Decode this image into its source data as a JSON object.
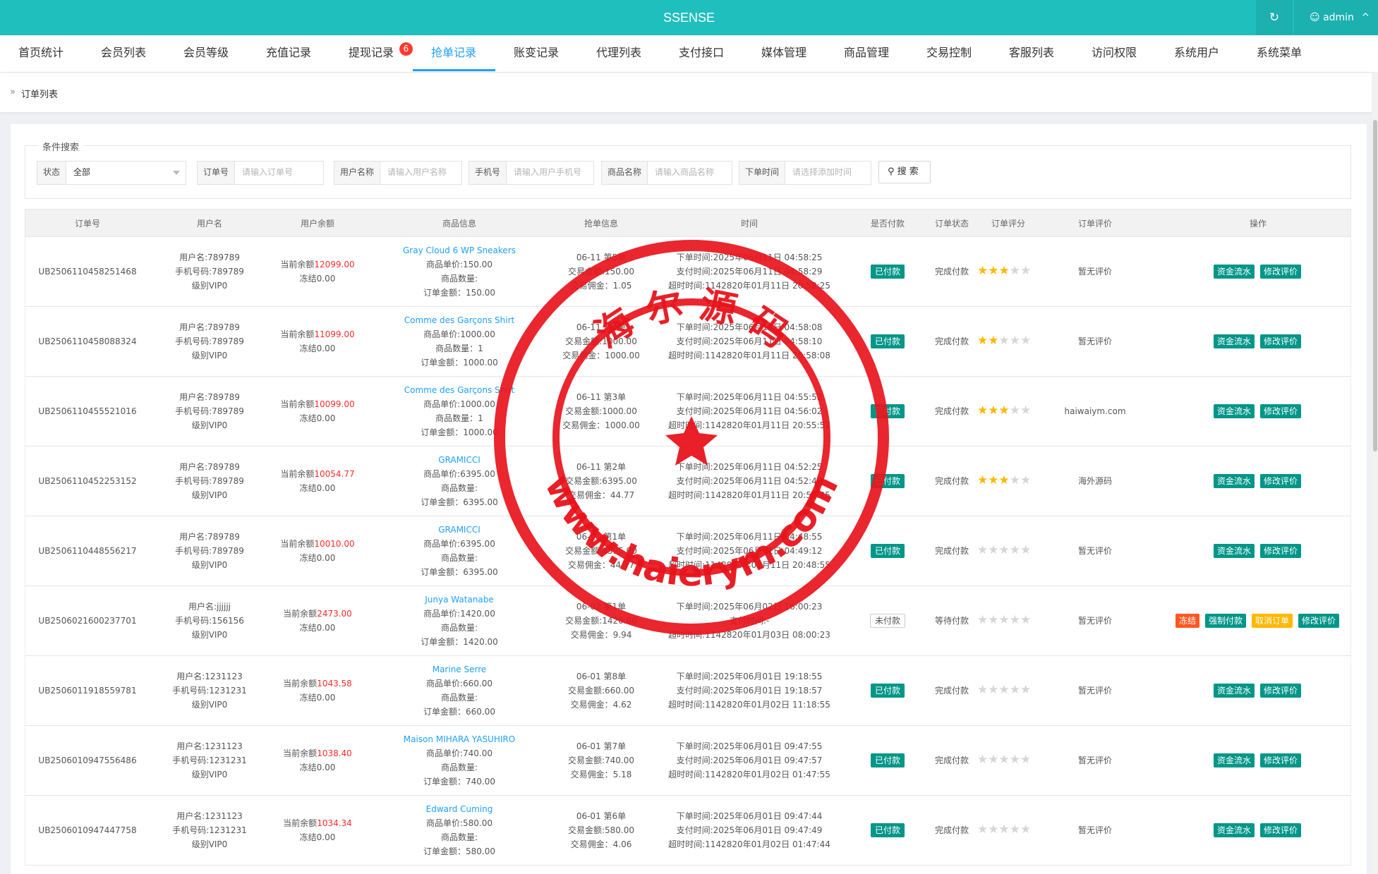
{
  "app": {
    "title": "SSENSE",
    "refresh_icon": "refresh-icon",
    "user_label": "admin",
    "user_icon": "user-icon",
    "user_caret": "^"
  },
  "nav": {
    "items": [
      {
        "label": "首页统计"
      },
      {
        "label": "会员列表"
      },
      {
        "label": "会员等级"
      },
      {
        "label": "充值记录"
      },
      {
        "label": "提现记录",
        "badge": "6"
      },
      {
        "label": "抢单记录",
        "active": true
      },
      {
        "label": "账变记录"
      },
      {
        "label": "代理列表"
      },
      {
        "label": "支付接口"
      },
      {
        "label": "媒体管理"
      },
      {
        "label": "商品管理"
      },
      {
        "label": "交易控制"
      },
      {
        "label": "客服列表"
      },
      {
        "label": "访问权限"
      },
      {
        "label": "系统用户"
      },
      {
        "label": "系统菜单"
      }
    ]
  },
  "breadcrumb": {
    "icon": "»",
    "label": "订单列表"
  },
  "search": {
    "legend": "条件搜索",
    "status": {
      "label": "状态",
      "value": "全部"
    },
    "order_no": {
      "label": "订单号",
      "placeholder": "请输入订单号"
    },
    "username": {
      "label": "用户名称",
      "placeholder": "请输入用户名称"
    },
    "phone": {
      "label": "手机号",
      "placeholder": "请输入用户手机号"
    },
    "goods": {
      "label": "商品名称",
      "placeholder": "请输入商品名称"
    },
    "time": {
      "label": "下单时间",
      "placeholder": "请选择添加时间"
    },
    "button": "搜 索"
  },
  "table": {
    "headers": [
      "订单号",
      "用户名",
      "用户余额",
      "商品信息",
      "抢单信息",
      "时间",
      "是否付款",
      "订单状态",
      "订单评分",
      "订单评价",
      "操作"
    ],
    "rows": [
      {
        "order_no": "UB2506110458251468",
        "user": "用户名:789789",
        "phone": "手机号码:789789",
        "level": "级别VIP0",
        "bal_prefix": "当前余额",
        "bal": "12099.00",
        "frozen": "冻结0.00",
        "goods": "Gray Cloud 6 WP Sneakers",
        "price": "商品单价:150.00",
        "qty": "商品数量:",
        "amount": "订单金额：150.00",
        "grab": "06-11 第5单",
        "deal": "交易金额:150.00",
        "comm": "交易佣金：1.05",
        "t1": "下单时间:2025年06月11日 04:58:25",
        "t2": "支付时间:2025年06月11日 04:58:29",
        "t3": "超时时间:1142820年01月11日 20:58:25",
        "paid": "已付款",
        "status": "完成付款",
        "stars": 3,
        "review": "暂无评价",
        "actions": [
          "资金流水",
          "修改评价"
        ]
      },
      {
        "order_no": "UB2506110458088324",
        "user": "用户名:789789",
        "phone": "手机号码:789789",
        "level": "级别VIP0",
        "bal_prefix": "当前余额",
        "bal": "11099.00",
        "frozen": "冻结0.00",
        "goods": "Comme des Garçons Shirt",
        "price": "商品单价:1000.00",
        "qty": "商品数量：1",
        "amount": "订单金额：1000.00",
        "grab": "06-11 第4单",
        "deal": "交易金额:1000.00",
        "comm": "交易佣金：1000.00",
        "t1": "下单时间:2025年06月11日 04:58:08",
        "t2": "支付时间:2025年06月11日 04:58:10",
        "t3": "超时时间:1142820年01月11日 20:58:08",
        "paid": "已付款",
        "status": "完成付款",
        "stars": 2,
        "review": "暂无评价",
        "actions": [
          "资金流水",
          "修改评价"
        ]
      },
      {
        "order_no": "UB2506110455521016",
        "user": "用户名:789789",
        "phone": "手机号码:789789",
        "level": "级别VIP0",
        "bal_prefix": "当前余额",
        "bal": "10099.00",
        "frozen": "冻结0.00",
        "goods": "Comme des Garçons Shirt",
        "price": "商品单价:1000.00",
        "qty": "商品数量：1",
        "amount": "订单金额：1000.00",
        "grab": "06-11 第3单",
        "deal": "交易金额:1000.00",
        "comm": "交易佣金：1000.00",
        "t1": "下单时间:2025年06月11日 04:55:52",
        "t2": "支付时间:2025年06月11日 04:56:02",
        "t3": "超时时间:1142820年01月11日 20:55:52",
        "paid": "已付款",
        "status": "完成付款",
        "stars": 3,
        "review": "haiwaiym.com",
        "actions": [
          "资金流水",
          "修改评价"
        ]
      },
      {
        "order_no": "UB2506110452253152",
        "user": "用户名:789789",
        "phone": "手机号码:789789",
        "level": "级别VIP0",
        "bal_prefix": "当前余额",
        "bal": "10054.77",
        "frozen": "冻结0.00",
        "goods": "GRAMICCI",
        "price": "商品单价:6395.00",
        "qty": "商品数量:",
        "amount": "订单金额：6395.00",
        "grab": "06-11 第2单",
        "deal": "交易金额:6395.00",
        "comm": "交易佣金：44.77",
        "t1": "下单时间:2025年06月11日 04:52:25",
        "t2": "支付时间:2025年06月11日 04:52:47",
        "t3": "超时时间:1142820年01月11日 20:52:25",
        "paid": "已付款",
        "status": "完成付款",
        "stars": 3,
        "review": "海外源码",
        "actions": [
          "资金流水",
          "修改评价"
        ]
      },
      {
        "order_no": "UB2506110448556217",
        "user": "用户名:789789",
        "phone": "手机号码:789789",
        "level": "级别VIP0",
        "bal_prefix": "当前余额",
        "bal": "10010.00",
        "frozen": "冻结0.00",
        "goods": "GRAMICCI",
        "price": "商品单价:6395.00",
        "qty": "商品数量:",
        "amount": "订单金额：6395.00",
        "grab": "06-11 第1单",
        "deal": "交易金额:6395.00",
        "comm": "交易佣金：44.77",
        "t1": "下单时间:2025年06月11日 04:48:55",
        "t2": "支付时间:2025年06月11日 04:49:12",
        "t3": "超时时间:1142820年01月11日 20:48:55",
        "paid": "已付款",
        "status": "完成付款",
        "stars": 0,
        "review": "暂无评价",
        "actions": [
          "资金流水",
          "修改评价"
        ]
      },
      {
        "order_no": "UB2506021600237701",
        "user": "用户名:jjjjjj",
        "phone": "手机号码:156156",
        "level": "级别VIP0",
        "bal_prefix": "当前余额",
        "bal": "2473.00",
        "frozen": "冻结0.00",
        "goods": "Junya Watanabe",
        "price": "商品单价:1420.00",
        "qty": "商品数量:",
        "amount": "订单金额：1420.00",
        "grab": "06-02 第1单",
        "deal": "交易金额:1420.00",
        "comm": "交易佣金：9.94",
        "t1": "下单时间:2025年06月02日 16:00:23",
        "t2": "支付时间:-",
        "t3": "超时时间:1142820年01月03日 08:00:23",
        "paid": "未付款",
        "status": "等待付款",
        "stars": 0,
        "review": "暂无评价",
        "actions": [
          "冻结",
          "强制付款",
          "取消订单",
          "修改评价"
        ]
      },
      {
        "order_no": "UB2506011918559781",
        "user": "用户名:1231123",
        "phone": "手机号码:1231231",
        "level": "级别VIP0",
        "bal_prefix": "当前余额",
        "bal": "1043.58",
        "frozen": "冻结0.00",
        "goods": "Marine Serre",
        "price": "商品单价:660.00",
        "qty": "商品数量:",
        "amount": "订单金额：660.00",
        "grab": "06-01 第8单",
        "deal": "交易金额:660.00",
        "comm": "交易佣金：4.62",
        "t1": "下单时间:2025年06月01日 19:18:55",
        "t2": "支付时间:2025年06月01日 19:18:57",
        "t3": "超时时间:1142820年01月02日 11:18:55",
        "paid": "已付款",
        "status": "完成付款",
        "stars": 0,
        "review": "暂无评价",
        "actions": [
          "资金流水",
          "修改评价"
        ]
      },
      {
        "order_no": "UB2506010947556486",
        "user": "用户名:1231123",
        "phone": "手机号码:1231231",
        "level": "级别VIP0",
        "bal_prefix": "当前余额",
        "bal": "1038.40",
        "frozen": "冻结0.00",
        "goods": "Maison MIHARA YASUHIRO",
        "price": "商品单价:740.00",
        "qty": "商品数量:",
        "amount": "订单金额：740.00",
        "grab": "06-01 第7单",
        "deal": "交易金额:740.00",
        "comm": "交易佣金：5.18",
        "t1": "下单时间:2025年06月01日 09:47:55",
        "t2": "支付时间:2025年06月01日 09:47:57",
        "t3": "超时时间:1142820年01月02日 01:47:55",
        "paid": "已付款",
        "status": "完成付款",
        "stars": 0,
        "review": "暂无评价",
        "actions": [
          "资金流水",
          "修改评价"
        ]
      },
      {
        "order_no": "UB2506010947447758",
        "user": "用户名:1231123",
        "phone": "手机号码:1231231",
        "level": "级别VIP0",
        "bal_prefix": "当前余额",
        "bal": "1034.34",
        "frozen": "冻结0.00",
        "goods": "Edward Cuming",
        "price": "商品单价:580.00",
        "qty": "商品数量:",
        "amount": "订单金额：580.00",
        "grab": "06-01 第6单",
        "deal": "交易金额:580.00",
        "comm": "交易佣金：4.06",
        "t1": "下单时间:2025年06月01日 09:47:44",
        "t2": "支付时间:2025年06月01日 09:47:49",
        "t3": "超时时间:1142820年01月02日 01:47:44",
        "paid": "已付款",
        "status": "完成付款",
        "stars": 0,
        "review": "暂无评价",
        "actions": [
          "资金流水",
          "修改评价"
        ]
      }
    ]
  },
  "watermark": {
    "top_text": "海 尔 源 码",
    "bottom_text": "www.haierym.com",
    "color": "#e8141c"
  }
}
